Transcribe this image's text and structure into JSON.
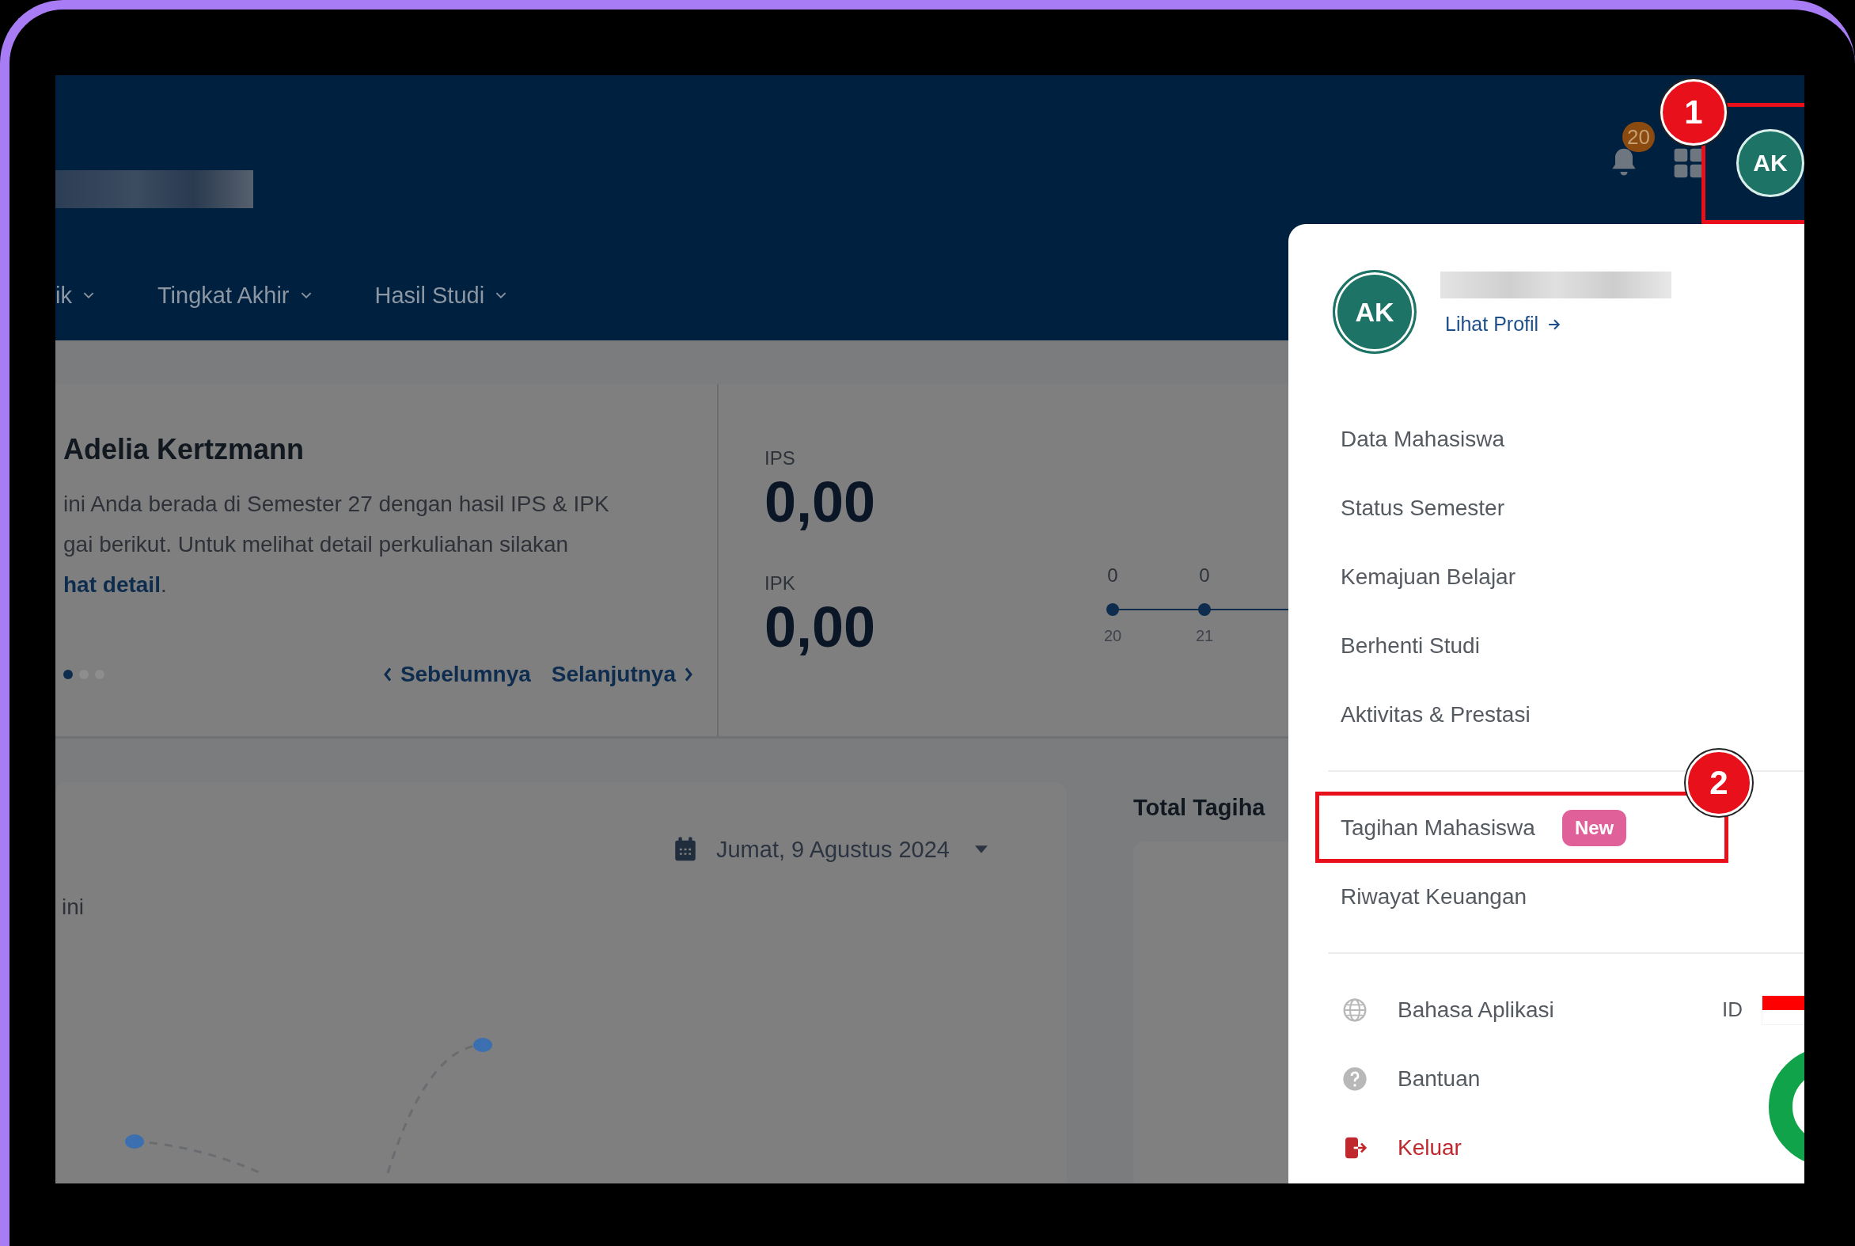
{
  "header": {
    "nav_items": [
      {
        "label": "ik"
      },
      {
        "label": "Tingkat Akhir"
      },
      {
        "label": "Hasil Studi"
      }
    ],
    "notification_count": "20",
    "avatar_initials": "AK"
  },
  "welcome_card": {
    "title": "Adelia Kertzmann",
    "lines": [
      "ini Anda berada di Semester 27 dengan hasil IPS & IPK",
      "gai berikut. Untuk melihat detail perkuliahan silakan"
    ],
    "link": "hat detail",
    "link_suffix": ".",
    "dots": [
      {
        "selected": true
      },
      {
        "selected": false
      },
      {
        "selected": false
      }
    ],
    "prev": "Sebelumnya",
    "next": "Selanjutnya"
  },
  "scores": [
    {
      "label": "IPS",
      "value": "0,00"
    },
    {
      "label": "IPK",
      "value": "0,00"
    }
  ],
  "semester_timeline": [
    {
      "value": "0",
      "semester": "20"
    },
    {
      "value": "0",
      "semester": "21"
    }
  ],
  "schedule": {
    "date": "Jumat, 9 Agustus 2024",
    "text": "ini"
  },
  "billing": {
    "title": "Total Tagiha"
  },
  "profile_menu": {
    "avatar_initials": "AK",
    "profile_link": "Lihat Profil",
    "groups": [
      [
        {
          "kind": "plain",
          "label": "Data Mahasiswa"
        },
        {
          "kind": "plain",
          "label": "Status Semester"
        },
        {
          "kind": "plain",
          "label": "Kemajuan Belajar"
        },
        {
          "kind": "plain",
          "label": "Berhenti Studi"
        },
        {
          "kind": "plain",
          "label": "Aktivitas & Prestasi"
        }
      ],
      [
        {
          "kind": "badge",
          "label": "Tagihan Mahasiswa",
          "badge": "New"
        },
        {
          "kind": "plain",
          "label": "Riwayat Keuangan"
        }
      ],
      [
        {
          "kind": "language",
          "label": "Bahasa Aplikasi",
          "value": "ID"
        },
        {
          "kind": "help",
          "label": "Bantuan"
        },
        {
          "kind": "logout",
          "label": "Keluar"
        }
      ]
    ]
  },
  "annotations": [
    {
      "label": "1"
    },
    {
      "label": "2"
    }
  ]
}
